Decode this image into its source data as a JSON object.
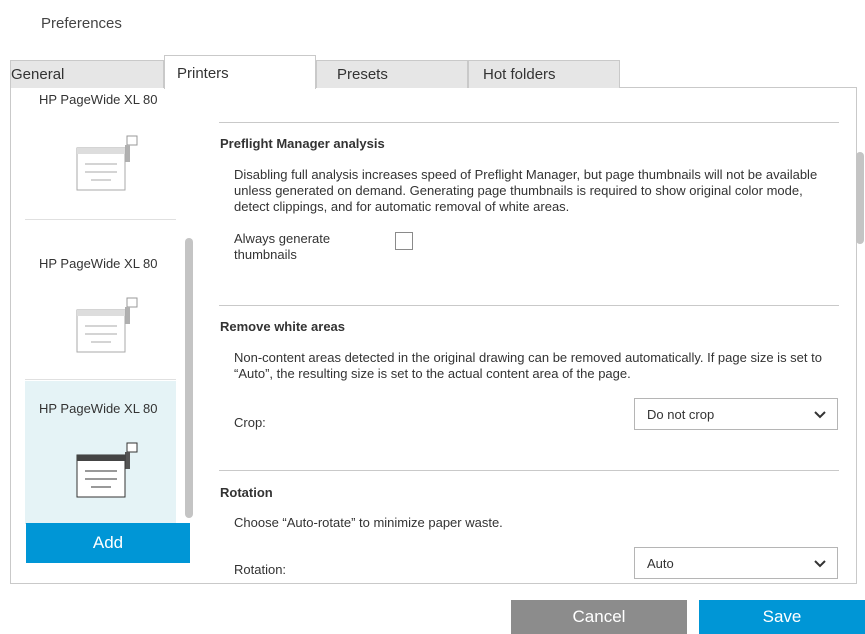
{
  "window": {
    "title": "Preferences"
  },
  "tabs": [
    {
      "label": "General"
    },
    {
      "label": "Printers"
    },
    {
      "label": "Presets"
    },
    {
      "label": "Hot folders"
    }
  ],
  "active_tab": "Printers",
  "printers": {
    "items": [
      {
        "name": "HP PageWide XL 80",
        "selected": false
      },
      {
        "name": "HP PageWide XL 80",
        "selected": false
      },
      {
        "name": "HP PageWide XL 80",
        "selected": true
      }
    ],
    "add_label": "Add"
  },
  "preflight": {
    "title": "Preflight Manager analysis",
    "description": "Disabling full analysis increases speed of Preflight Manager, but page thumbnails will not be available unless generated on demand. Generating page thumbnails is required to show original color mode, detect clippings, and for automatic removal of white areas.",
    "always_generate_label": "Always generate thumbnails",
    "always_generate_checked": false
  },
  "remove_white": {
    "title": "Remove white areas",
    "description": "Non-content areas detected in the original drawing can be removed automatically. If page size is set to “Auto”, the resulting size is set to the actual content area of the page.",
    "crop_label": "Crop:",
    "crop_value": "Do not crop"
  },
  "rotation": {
    "title": "Rotation",
    "description": "Choose “Auto-rotate” to minimize paper waste.",
    "rotation_label": "Rotation:",
    "rotation_value": "Auto"
  },
  "footer": {
    "cancel_label": "Cancel",
    "save_label": "Save"
  },
  "colors": {
    "accent": "#0096d6",
    "cancel": "#8c8c8c",
    "selected_row": "#e5f3f6"
  }
}
